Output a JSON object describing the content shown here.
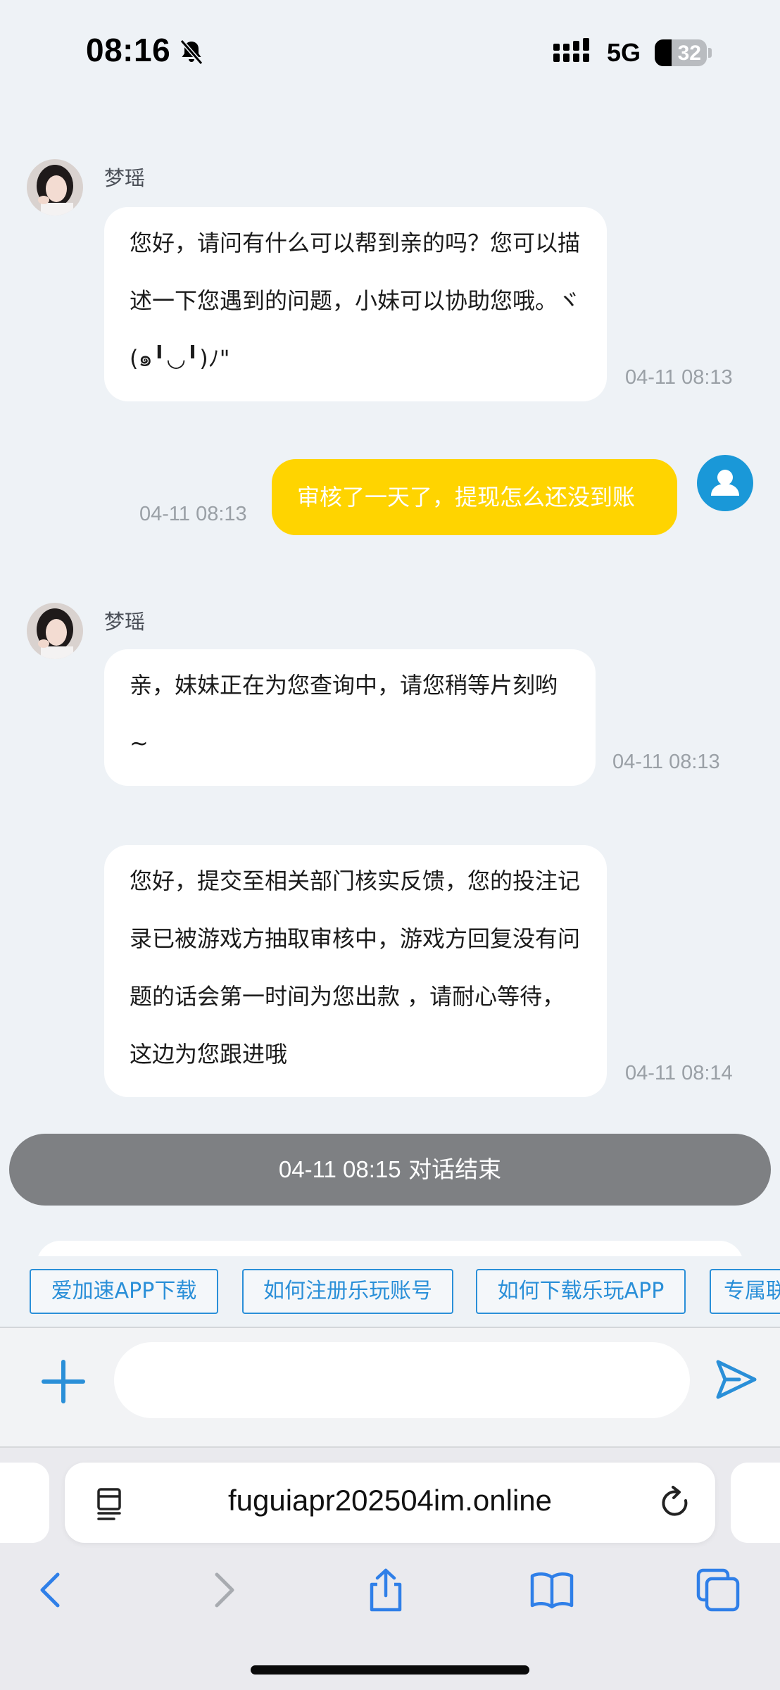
{
  "status_bar": {
    "time": "08:16",
    "network": "5G",
    "battery": "32",
    "battery_level": 0.32,
    "bell_icon": "bell-slash-icon",
    "signal_icon": "signal-bars-icon"
  },
  "chat": {
    "messages": [
      {
        "from": "agent",
        "sender": "梦瑶",
        "text": "您好，请问有什么可以帮到亲的吗？您可以描述一下您遇到的问题，小妹可以协助您哦。ヾ(๑╹◡╹)ﾉ\"",
        "time": "04-11 08:13"
      },
      {
        "from": "user",
        "text": "审核了一天了，提现怎么还没到账",
        "time": "04-11 08:13"
      },
      {
        "from": "agent",
        "sender": "梦瑶",
        "text": "亲，妹妹正在为您查询中，请您稍等片刻哟~",
        "time": "04-11 08:13"
      },
      {
        "from": "agent",
        "text": "您好，提交至相关部门核实反馈，您的投注记录已被游戏方抽取审核中，游戏方回复没有问题的话会第一时间为您出款 ，请耐心等待，这边为您跟进哦",
        "time": "04-11 08:14"
      }
    ],
    "end_time": "04-11 08:15",
    "end_label": "对话结束"
  },
  "quick_replies": [
    "爱加速APP下载",
    "如何注册乐玩账号",
    "如何下载乐玩APP",
    "专属联系"
  ],
  "input": {
    "placeholder": "",
    "value": "",
    "plus_icon": "plus-icon",
    "send_icon": "send-icon"
  },
  "browser": {
    "url": "fuguiapr202504im.online",
    "reader_icon": "reader-mode-icon",
    "reload_icon": "reload-icon",
    "nav": [
      "back-icon",
      "forward-icon",
      "share-icon",
      "bookmarks-icon",
      "tabs-icon"
    ]
  },
  "colors": {
    "page_bg": "#eef2f6",
    "user_bubble": "#ffd400",
    "accent": "#2a8fd8",
    "end_pill": "#7e8083",
    "user_avatar": "#1a98d8"
  }
}
